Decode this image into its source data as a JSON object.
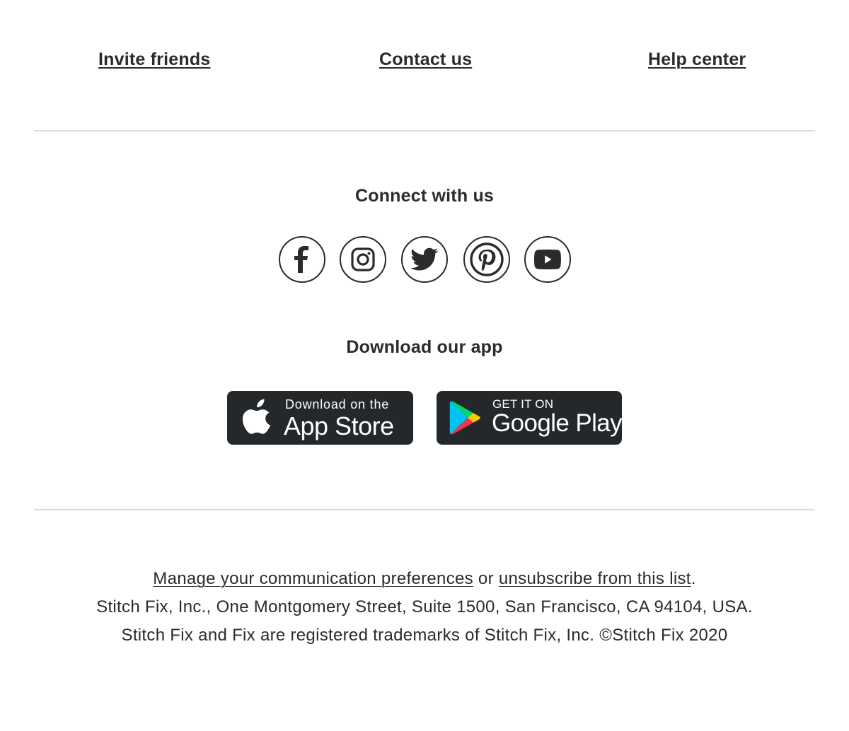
{
  "nav_links": {
    "invite": "Invite friends",
    "contact": "Contact us",
    "help": "Help center"
  },
  "connect": {
    "heading": "Connect with us",
    "icons": [
      "facebook-icon",
      "instagram-icon",
      "twitter-icon",
      "pinterest-icon",
      "youtube-icon"
    ]
  },
  "app": {
    "heading": "Download our app",
    "app_store": {
      "small": "Download on the",
      "big": "App Store"
    },
    "google_play": {
      "small": "GET IT ON",
      "big": "Google Play"
    }
  },
  "footer": {
    "manage_link": "Manage your communication preferences",
    "or": "or",
    "unsubscribe_link": "unsubscribe from this list",
    "period": ".",
    "address": "Stitch Fix, Inc., One Montgomery Street, Suite 1500, San Francisco, CA 94104, USA.",
    "trademark": "Stitch Fix and Fix are registered trademarks of Stitch Fix, Inc. ©Stitch Fix 2020"
  },
  "colors": {
    "text": "#2b2b2b",
    "divider": "#dcdcdc",
    "badge_bg": "#25282b"
  }
}
